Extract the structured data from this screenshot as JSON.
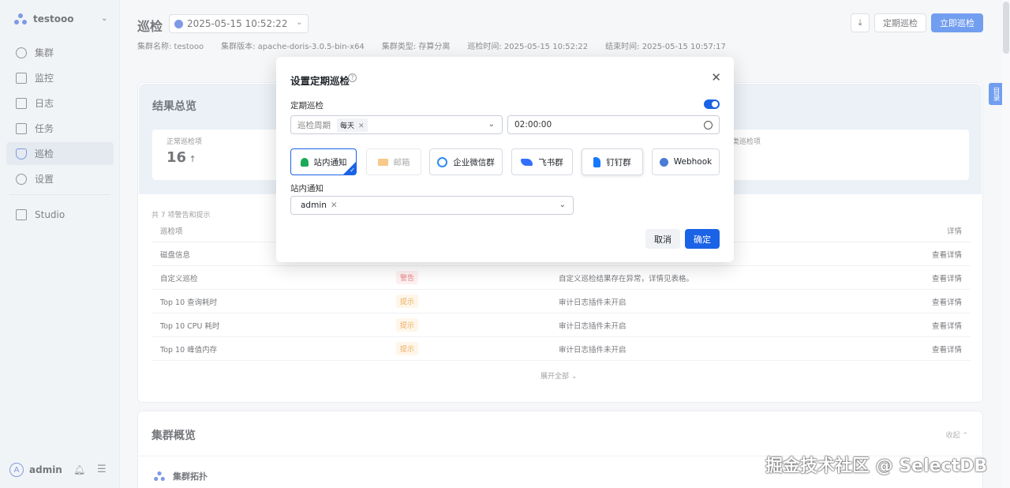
{
  "sidebar": {
    "cluster_name": "testooo",
    "items": [
      {
        "label": "集群",
        "icon": "cluster-icon"
      },
      {
        "label": "监控",
        "icon": "monitor-icon"
      },
      {
        "label": "日志",
        "icon": "log-icon"
      },
      {
        "label": "任务",
        "icon": "task-icon"
      },
      {
        "label": "巡检",
        "icon": "inspection-icon",
        "active": true
      },
      {
        "label": "设置",
        "icon": "gear-icon"
      },
      {
        "label": "Studio",
        "icon": "external-link-icon"
      }
    ],
    "user": {
      "avatar_letter": "A",
      "name": "admin"
    }
  },
  "header": {
    "title": "巡检",
    "date_value": "2025-05-15 10:52:22",
    "meta": {
      "cluster_name": "集群名称: testooo",
      "cluster_version": "集群版本: apache-doris-3.0.5-bin-x64",
      "cluster_type": "集群类型: 存算分离",
      "inspect_time": "巡检时间: 2025-05-15 10:52:22",
      "end_time": "结束时间: 2025-05-15 10:57:17"
    },
    "buttons": {
      "scheduled": "定期巡检",
      "now": "立即巡检"
    }
  },
  "results": {
    "title": "结果总览",
    "normal_label": "正常巡检项",
    "normal_value": "16",
    "other_label": "类巡检项",
    "summary": "共 7 项警告和提示",
    "columns": [
      "巡检项",
      "",
      "",
      "详情"
    ],
    "rows": [
      {
        "item": "磁盘信息",
        "level": "",
        "desc": "",
        "detail": "查看详情"
      },
      {
        "item": "自定义巡检",
        "level": "警告",
        "level_type": "warn",
        "desc": "自定义巡检结果存在异常，详情见表格。",
        "detail": "查看详情"
      },
      {
        "item": "Top 10 查询耗时",
        "level": "提示",
        "level_type": "tip",
        "desc": "审计日志插件未开启",
        "detail": "查看详情"
      },
      {
        "item": "Top 10 CPU 耗时",
        "level": "提示",
        "level_type": "tip",
        "desc": "审计日志插件未开启",
        "detail": "查看详情"
      },
      {
        "item": "Top 10 峰值内存",
        "level": "提示",
        "level_type": "tip",
        "desc": "审计日志插件未开启",
        "detail": "查看详情"
      }
    ],
    "expand_all": "展开全部"
  },
  "overview": {
    "title": "集群概览",
    "collapse": "收起",
    "topology_title": "集群拓扑"
  },
  "modal": {
    "title": "设置定期巡检",
    "scheduled_label": "定期巡检",
    "scheduled_enabled": true,
    "period_placeholder": "巡检周期",
    "period_value": "每天",
    "time_value": "02:00:00",
    "channels": [
      {
        "label": "站内通知",
        "selected": true,
        "icon": "bell-icon",
        "color": "#1aaa55"
      },
      {
        "label": "邮箱",
        "disabled": true,
        "icon": "mail-icon",
        "color": "#f7c98a"
      },
      {
        "label": "企业微信群",
        "icon": "wecom-icon",
        "color": "#2d8cf0"
      },
      {
        "label": "飞书群",
        "icon": "feishu-icon",
        "color": "#3370ff"
      },
      {
        "label": "钉钉群",
        "icon": "dingtalk-icon",
        "color": "#1677ff"
      },
      {
        "label": "Webhook",
        "icon": "webhook-icon",
        "color": "#4a7bd4"
      }
    ],
    "notify_label": "站内通知",
    "notify_user": "admin",
    "cancel": "取消",
    "confirm": "确定"
  },
  "side_tab": "目录",
  "watermark": "掘金技术社区 @ SelectDB"
}
